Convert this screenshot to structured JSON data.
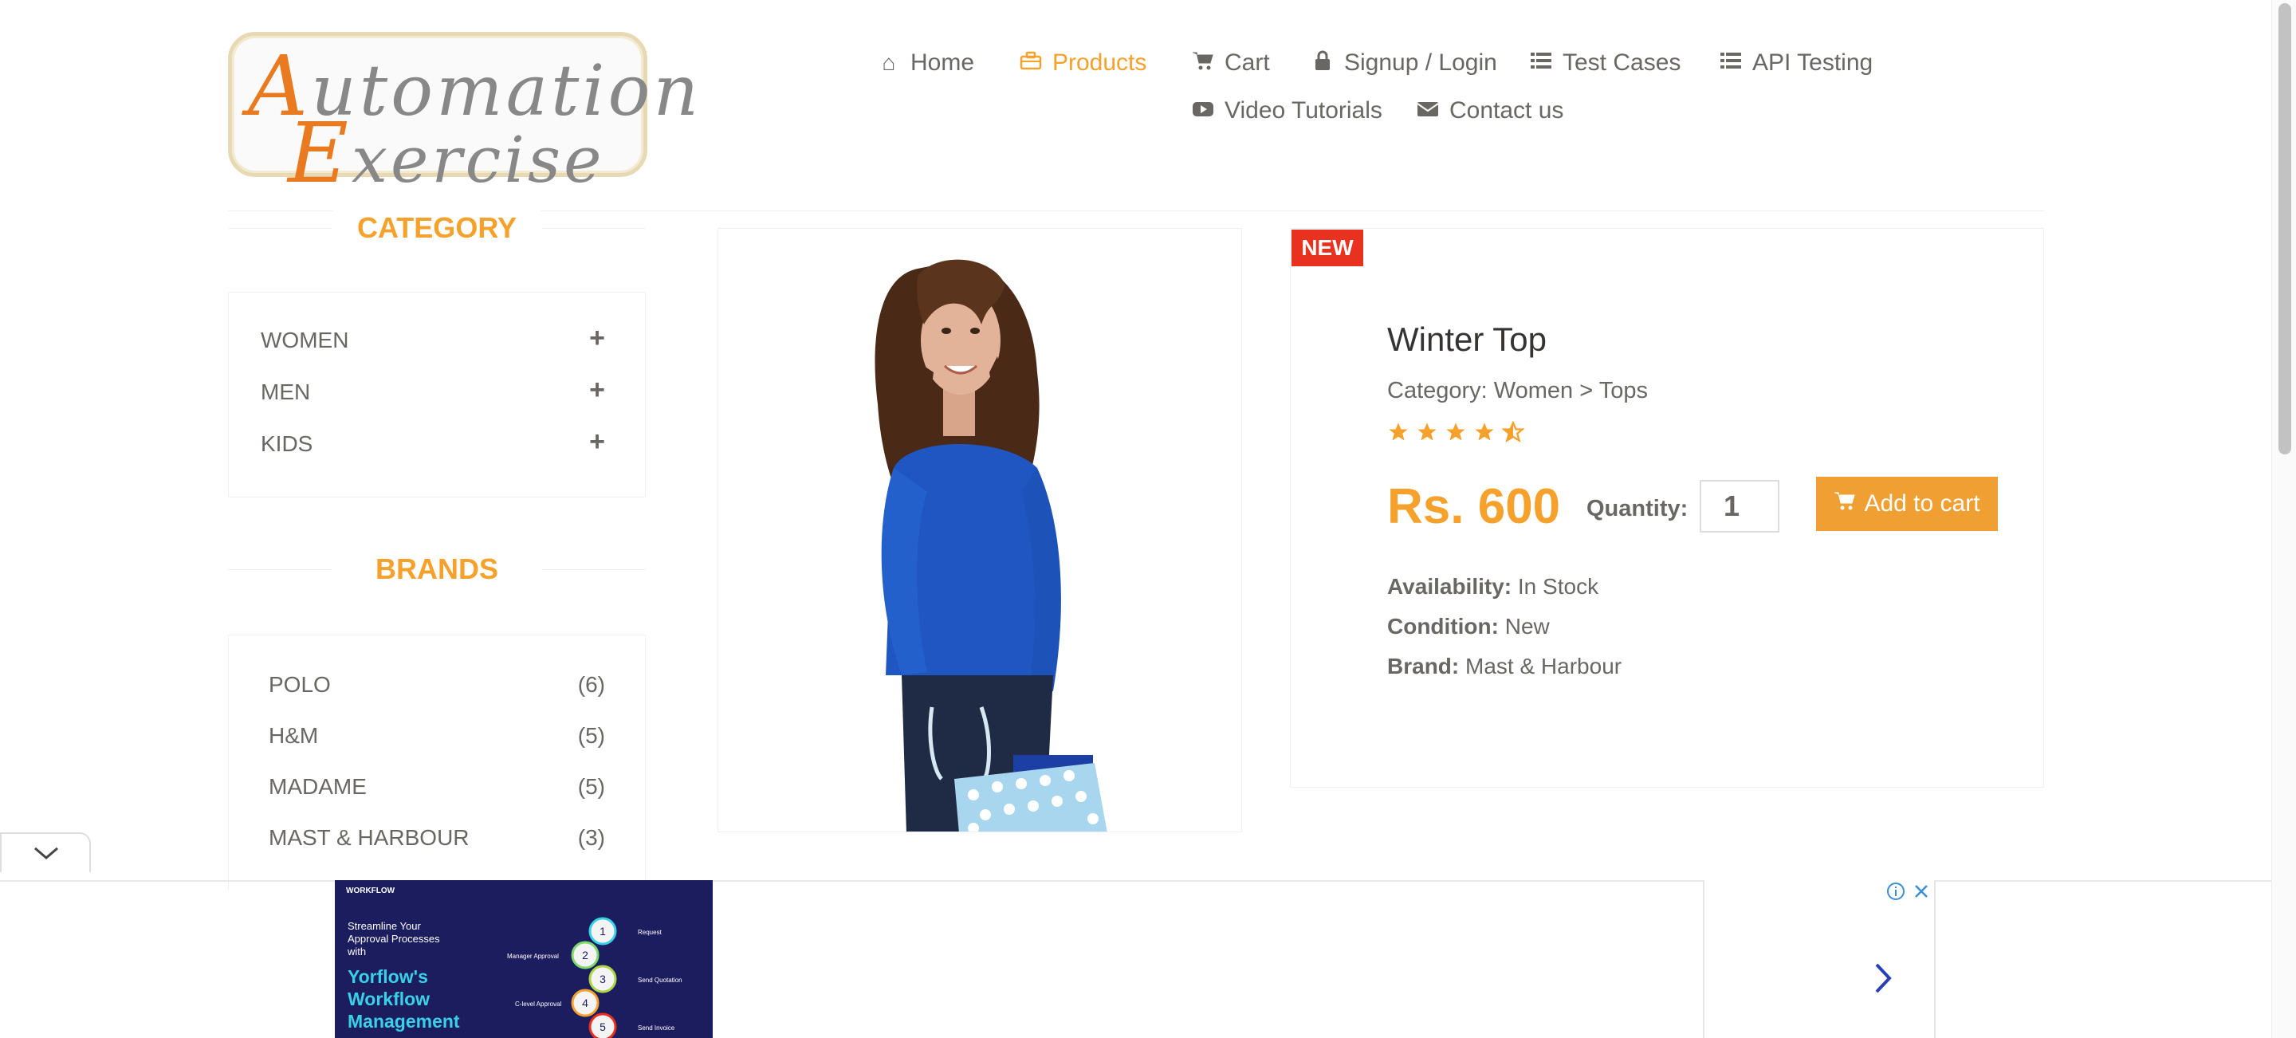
{
  "logo": {
    "line1": "Automation",
    "line2": "Exercise"
  },
  "nav": {
    "home": "Home",
    "products": "Products",
    "cart": "Cart",
    "signup": "Signup / Login",
    "test_cases": "Test Cases",
    "api_testing": "API Testing",
    "video_tutorials": "Video Tutorials",
    "contact": "Contact us"
  },
  "sidebar": {
    "category_title": "CATEGORY",
    "categories": [
      "WOMEN",
      "MEN",
      "KIDS"
    ],
    "brands_title": "BRANDS",
    "brands": [
      {
        "name": "POLO",
        "count": "(6)"
      },
      {
        "name": "H&M",
        "count": "(5)"
      },
      {
        "name": "MADAME",
        "count": "(5)"
      },
      {
        "name": "MAST & HARBOUR",
        "count": "(3)"
      }
    ]
  },
  "product": {
    "badge": "NEW",
    "name": "Winter Top",
    "category": "Category: Women > Tops",
    "rating": 4.5,
    "price": "Rs. 600",
    "quantity_label": "Quantity:",
    "quantity_value": "1",
    "add_to_cart": "Add to cart",
    "availability_label": "Availability:",
    "availability_value": "In Stock",
    "condition_label": "Condition:",
    "condition_value": "New",
    "brand_label": "Brand:",
    "brand_value": "Mast & Harbour"
  },
  "ad": {
    "brand": "WORKFLOW",
    "tagline": "Streamline Your Approval Processes with",
    "headline_1": "Yorflow's",
    "headline_2": "Workflow",
    "headline_3": "Management",
    "steps": [
      "Request",
      "Manager Approval",
      "Send Quotation",
      "C-level Approval",
      "Send Invoice"
    ]
  },
  "colors": {
    "accent": "#f5a12c",
    "badge": "#e8311f",
    "text": "#696763"
  }
}
